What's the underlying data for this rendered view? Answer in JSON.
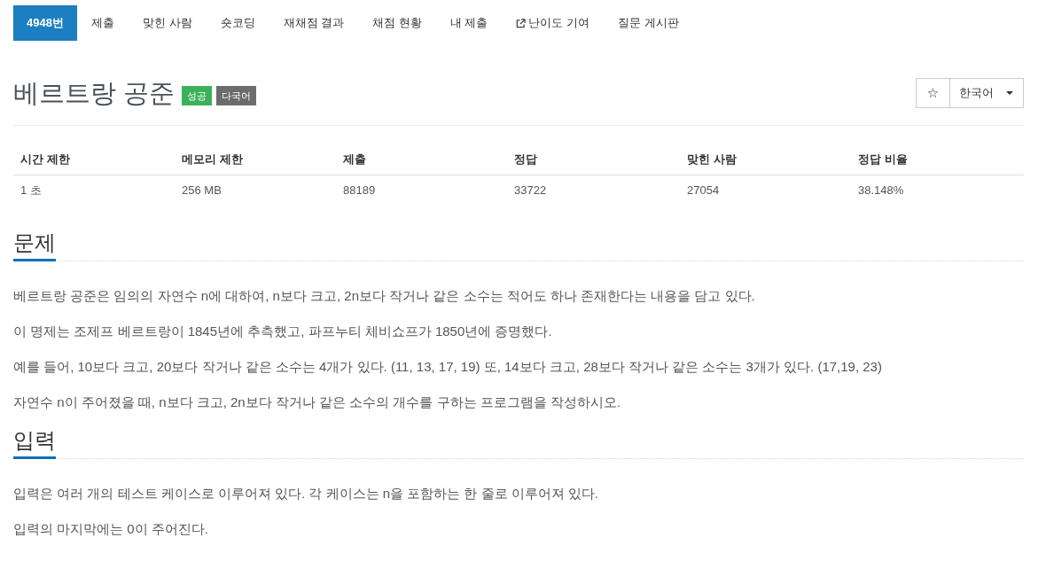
{
  "nav": {
    "tabs": [
      {
        "label": "4948번",
        "selected": true,
        "kind": "plain"
      },
      {
        "label": "제출",
        "selected": false,
        "kind": "plain"
      },
      {
        "label": "맞힌 사람",
        "selected": false,
        "kind": "plain"
      },
      {
        "label": "숏코딩",
        "selected": false,
        "kind": "plain"
      },
      {
        "label": "재채점 결과",
        "selected": false,
        "kind": "plain"
      },
      {
        "label": "채점 현황",
        "selected": false,
        "kind": "plain"
      },
      {
        "label": "내 제출",
        "selected": false,
        "kind": "plain"
      },
      {
        "label": "난이도 기여",
        "selected": false,
        "kind": "external"
      },
      {
        "label": "질문 게시판",
        "selected": false,
        "kind": "plain"
      }
    ]
  },
  "problem": {
    "title": "베르트랑 공준",
    "tags": [
      {
        "label": "성공",
        "color": "#3cb15a"
      },
      {
        "label": "다국어",
        "color": "#6c6c6c"
      }
    ]
  },
  "toolbar": {
    "star": "☆",
    "language": "한국어"
  },
  "stats": {
    "columns": [
      "시간 제한",
      "메모리 제한",
      "제출",
      "정답",
      "맞힌 사람",
      "정답 비율"
    ],
    "rows": [
      [
        "1 초",
        "256 MB",
        "88189",
        "33722",
        "27054",
        "38.148%"
      ]
    ]
  },
  "sections": [
    {
      "heading": "문제",
      "paragraphs": [
        "베르트랑 공준은 임의의 자연수 n에 대하여, n보다 크고, 2n보다 작거나 같은 소수는 적어도 하나 존재한다는 내용을 담고 있다.",
        "이 명제는 조제프 베르트랑이 1845년에 추측했고, 파프누티 체비쇼프가 1850년에 증명했다.",
        "예를 들어, 10보다 크고, 20보다 작거나 같은 소수는 4개가 있다. (11, 13, 17, 19) 또, 14보다 크고, 28보다 작거나 같은 소수는 3개가 있다. (17,19, 23)",
        "자연수 n이 주어졌을 때, n보다 크고, 2n보다 작거나 같은 소수의 개수를 구하는 프로그램을 작성하시오."
      ]
    },
    {
      "heading": "입력",
      "paragraphs": [
        "입력은 여러 개의 테스트 케이스로 이루어져 있다. 각 케이스는 n을 포함하는 한 줄로 이루어져 있다.",
        "입력의 마지막에는 0이 주어진다."
      ]
    }
  ]
}
